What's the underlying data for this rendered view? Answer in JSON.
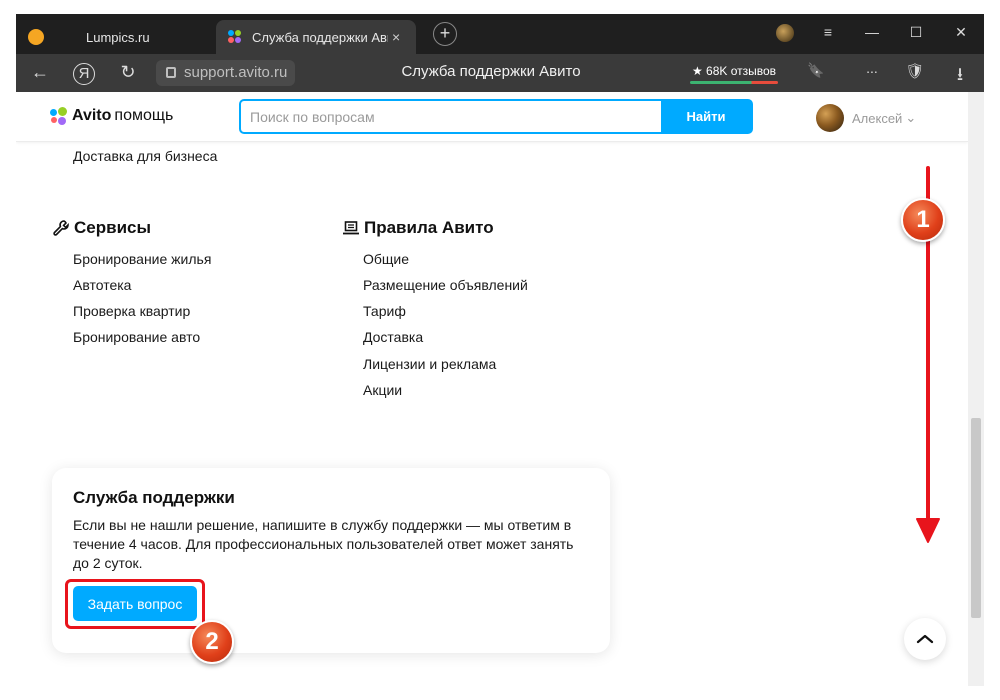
{
  "browser": {
    "tabs": [
      {
        "title": "Lumpics.ru"
      },
      {
        "title": "Служба поддержки Авито",
        "close": "×"
      }
    ],
    "new_tab": "+",
    "window_controls": {
      "menu": "≡",
      "minimize": "—",
      "maximize": "☐",
      "close": "✕"
    },
    "nav": {
      "back": "←",
      "yandex": "Я",
      "reload": "↻"
    },
    "url": "support.avito.ru",
    "page_title": "Служба поддержки Авито",
    "reviews": "★ 68K отзывов",
    "toolbar": {
      "bookmark": "🔖",
      "more": "...",
      "shield": "🛡",
      "download": "⭳"
    }
  },
  "site": {
    "logo": {
      "brand": "Avito",
      "suffix": "помощь"
    },
    "search": {
      "placeholder": "Поиск по вопросам",
      "button": "Найти"
    },
    "user": {
      "name": "Алексей",
      "chevron": "⌄"
    }
  },
  "content": {
    "top_link": "Доставка для бизнеса",
    "services": {
      "title": "Сервисы",
      "items": [
        "Бронирование жилья",
        "Автотека",
        "Проверка квартир",
        "Бронирование авто"
      ]
    },
    "rules": {
      "title": "Правила Авито",
      "items": [
        "Общие",
        "Размещение объявлений",
        "Тариф",
        "Доставка",
        "Лицензии и реклама",
        "Акции"
      ]
    },
    "support": {
      "title": "Служба поддержки",
      "text": "Если вы не нашли решение, напишите в службу поддержки — мы ответим в течение 4 часов. Для профессиональных пользователей ответ может занять до 2 суток.",
      "button": "Задать вопрос"
    }
  },
  "annotations": {
    "badge1": "1",
    "badge2": "2",
    "highlight_color": "#e8141c"
  },
  "colors": {
    "accent": "#00aaff",
    "browser_dark": "#2b2b2b"
  }
}
